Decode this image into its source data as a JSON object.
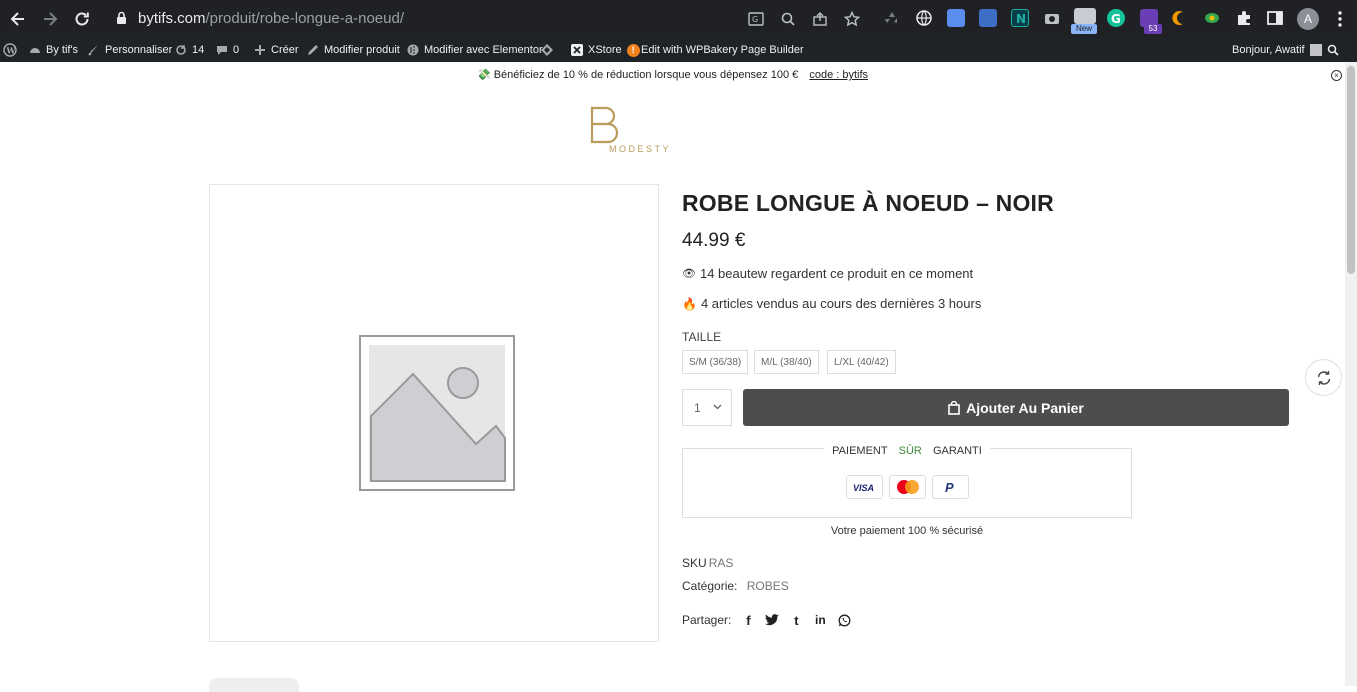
{
  "browser": {
    "url_domain": "bytifs.com",
    "url_path": "/produit/robe-longue-a-noeud/",
    "avatar_letter": "A",
    "ext_badge_new": "New",
    "ext_badge_count": "53"
  },
  "adminbar": {
    "site_name": "By tif's",
    "customize": "Personnaliser",
    "updates_count": "14",
    "comments_count": "0",
    "create": "Créer",
    "edit_product": "Modifier produit",
    "edit_elementor": "Modifier avec Elementor",
    "xstore": "XStore",
    "xstore_badge": "!",
    "wpbakery": "Edit with WPBakery Page Builder",
    "greeting": "Bonjour, Awatif"
  },
  "promo": {
    "text": "Bénéficiez de 10 % de réduction lorsque vous dépensez 100 €",
    "code": "code : bytifs"
  },
  "logo": {
    "text": "MODESTY",
    "color": "#b99b5c"
  },
  "product": {
    "title": "ROBE LONGUE À NOEUD – NOIR",
    "price": "44.99 €",
    "viewers": "14 beautew regardent ce produit en ce moment",
    "sold": "4 articles vendus au cours des dernières 3 hours",
    "size_label": "TAILLE",
    "sizes": [
      "S/M (36/38)",
      "M/L (38/40)",
      "L/XL (40/42)"
    ],
    "quantity": "1",
    "add_to_cart": "Ajouter Au Panier",
    "payment_legend_a": "PAIEMENT",
    "payment_legend_b": "SÛR",
    "payment_legend_c": "GARANTI",
    "payment_secure": "Votre paiement 100 % sécurisé",
    "sku_label": "SKU",
    "sku_value": "RAS",
    "category_label": "Catégorie:",
    "category_value": "ROBES",
    "share_label": "Partager:"
  },
  "colors": {
    "cart_button": "#4d4d4d",
    "chrome_bg": "#202124",
    "adminbar_bg": "#1d2327"
  }
}
